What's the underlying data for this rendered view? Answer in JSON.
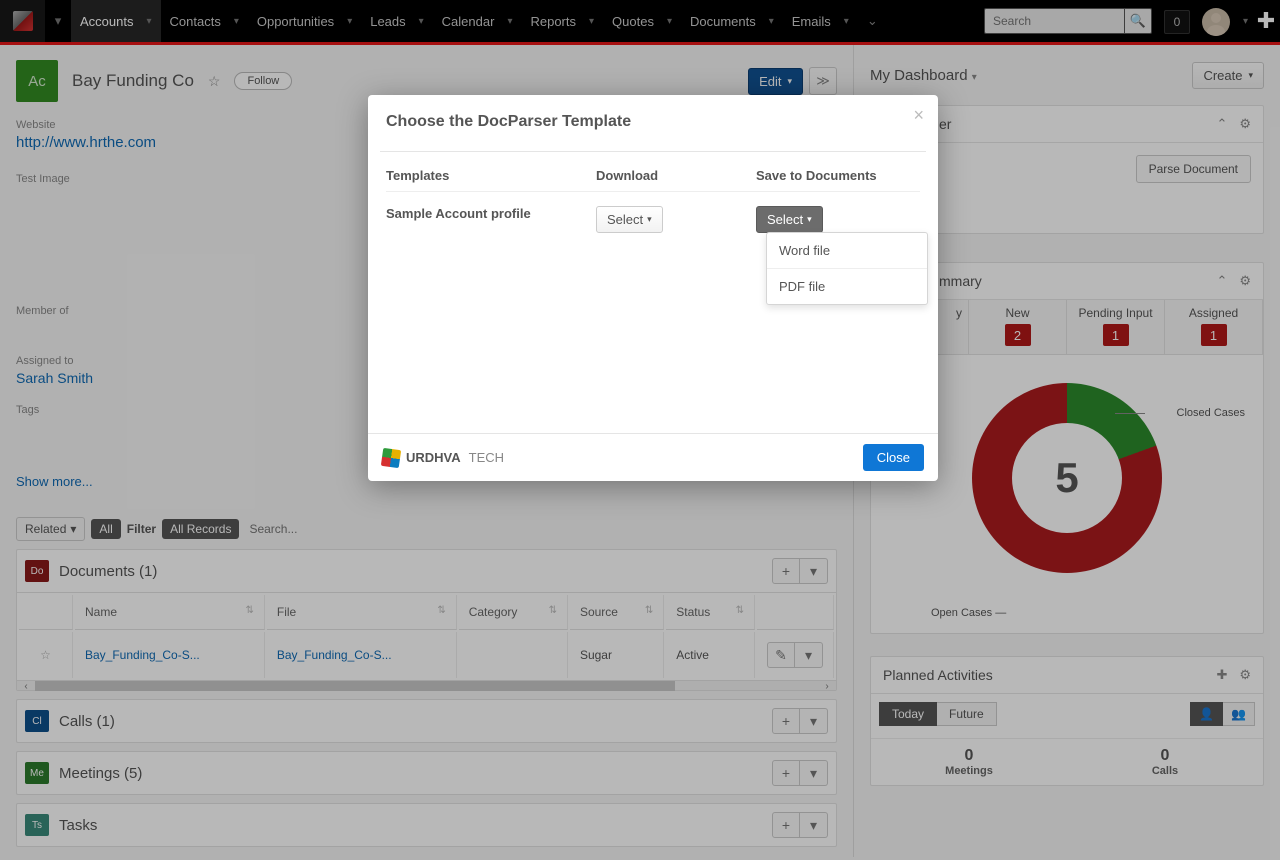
{
  "nav": {
    "items": [
      "Accounts",
      "Contacts",
      "Opportunities",
      "Leads",
      "Calendar",
      "Reports",
      "Quotes",
      "Documents",
      "Emails"
    ],
    "search_placeholder": "Search",
    "notif_count": "0"
  },
  "record": {
    "badge": "Ac",
    "title": "Bay Funding Co",
    "follow": "Follow",
    "edit": "Edit",
    "website_label": "Website",
    "website_url": "http://www.hrthe.com",
    "test_image_label": "Test Image",
    "member_of_label": "Member of",
    "assigned_to_label": "Assigned to",
    "assigned_to_value": "Sarah Smith",
    "tags_label": "Tags",
    "show_more": "Show more..."
  },
  "related_bar": {
    "related": "Related",
    "all": "All",
    "filter": "Filter",
    "all_records": "All Records",
    "search_placeholder": "Search..."
  },
  "docs": {
    "title": "Documents (1)",
    "badge": "Do",
    "cols": {
      "name": "Name",
      "file": "File",
      "category": "Category",
      "source": "Source",
      "status": "Status"
    },
    "row": {
      "name": "Bay_Funding_Co-S...",
      "file": "Bay_Funding_Co-S...",
      "category": "",
      "source": "Sugar",
      "status": "Active"
    }
  },
  "panels": {
    "calls": {
      "badge": "Cl",
      "title": "Calls (1)"
    },
    "meetings": {
      "badge": "Me",
      "title": "Meetings (5)"
    },
    "tasks": {
      "badge": "Ts",
      "title": "Tasks"
    }
  },
  "dashboard": {
    "title": "My Dashboard",
    "create": "Create",
    "docparser_title_fragment": "er",
    "parse_document": "Parse Document",
    "cases": {
      "title_fragment": "mmary",
      "headers": {
        "summary_fragment": "y",
        "new": "New",
        "pending": "Pending Input",
        "assigned": "Assigned"
      },
      "counts": {
        "new": "2",
        "pending": "1",
        "assigned": "1"
      },
      "donut_total": "5",
      "legend_open": "Open Cases",
      "legend_closed": "Closed Cases"
    },
    "planned": {
      "title": "Planned Activities",
      "today": "Today",
      "future": "Future",
      "meetings_n": "0",
      "meetings_l": "Meetings",
      "calls_n": "0",
      "calls_l": "Calls"
    }
  },
  "modal": {
    "title": "Choose the DocParser Template",
    "col_templates": "Templates",
    "col_download": "Download",
    "col_save": "Save to Documents",
    "template_name": "Sample Account profile",
    "select": "Select",
    "dropdown": {
      "word": "Word file",
      "pdf": "PDF file"
    },
    "brand": "URDHVA",
    "brand_suffix": "TECH",
    "close": "Close"
  },
  "colors": {
    "calls_badge": "#0d4f8b",
    "meetings_badge": "#2c7a2c",
    "tasks_badge": "#3a8a7a",
    "docs_badge": "#8a1a1a"
  }
}
